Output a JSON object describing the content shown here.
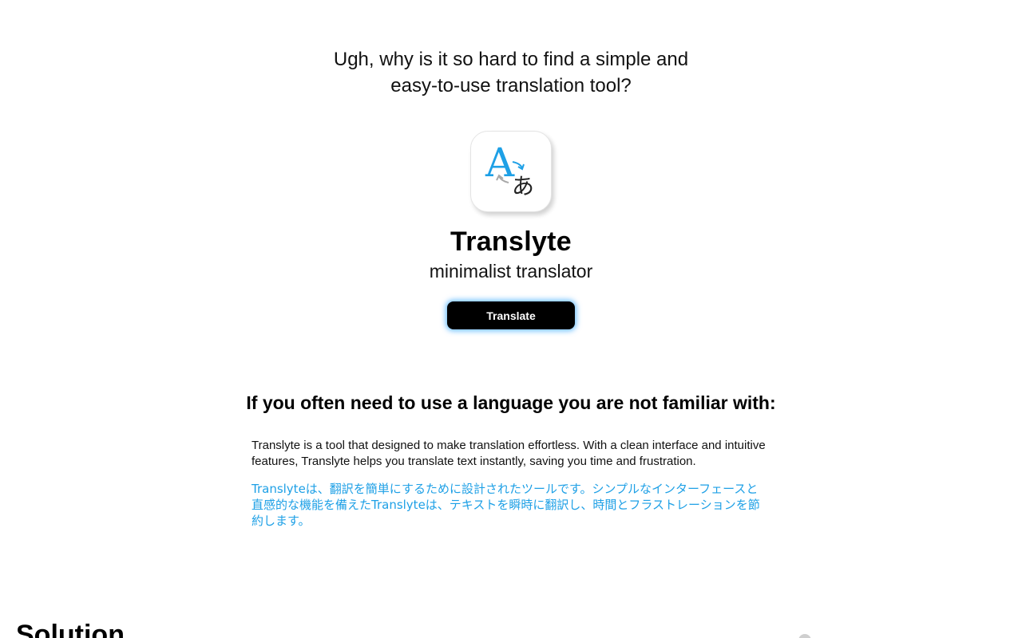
{
  "hero": {
    "question_line1": "Ugh, why is it so hard to find a simple and",
    "question_line2": "easy-to-use translation tool?"
  },
  "app": {
    "icon_letter_latin": "A",
    "icon_letter_japanese": "あ",
    "name": "Translyte",
    "tagline": "minimalist translator",
    "translate_label": "Translate"
  },
  "section": {
    "heading": "If you often need to use a language you are not familiar with:",
    "description_en": "Translyte is a tool that designed to make translation effortless. With a clean interface and intuitive features, Translyte helps you translate text instantly, saving you time and frustration.",
    "description_ja": "Translyteは、翻訳を簡単にするために設計されたツールです。シンプルなインターフェースと直感的な機能を備えたTranslyteは、テキストを瞬時に翻訳し、時間とフラストレーションを節約します。"
  },
  "solution": {
    "heading": "Solution"
  },
  "colors": {
    "accent_blue": "#1ea0e6",
    "button_bg": "#000000",
    "button_glow": "#3caaff"
  }
}
